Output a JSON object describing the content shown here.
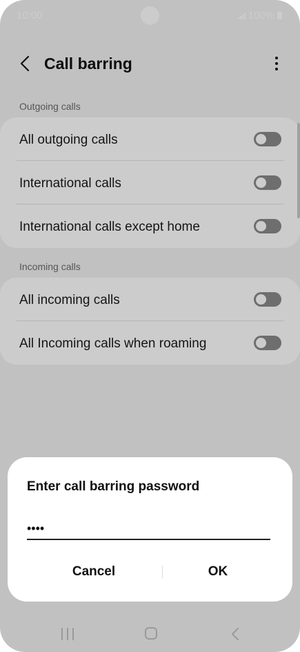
{
  "status_bar": {
    "time": "10:00",
    "battery": "100%"
  },
  "header": {
    "title": "Call barring"
  },
  "sections": [
    {
      "label": "Outgoing calls",
      "items": [
        {
          "label": "All outgoing calls",
          "enabled": false
        },
        {
          "label": "International calls",
          "enabled": false
        },
        {
          "label": "International calls except home",
          "enabled": false
        }
      ]
    },
    {
      "label": "Incoming calls",
      "items": [
        {
          "label": "All incoming calls",
          "enabled": false
        },
        {
          "label": "All Incoming calls when roaming",
          "enabled": false
        }
      ]
    }
  ],
  "dialog": {
    "title": "Enter call barring password",
    "password_value": "••••",
    "cancel_label": "Cancel",
    "ok_label": "OK"
  },
  "icons": [
    "back-arrow-icon",
    "more-options-icon",
    "recent-apps-icon",
    "home-icon",
    "nav-back-icon"
  ],
  "colors": {
    "background": "#f2f2f2",
    "card": "#ffffff",
    "toggle_off": "#8a8a8a",
    "scrim": "rgba(0,0,0,0.20)"
  }
}
